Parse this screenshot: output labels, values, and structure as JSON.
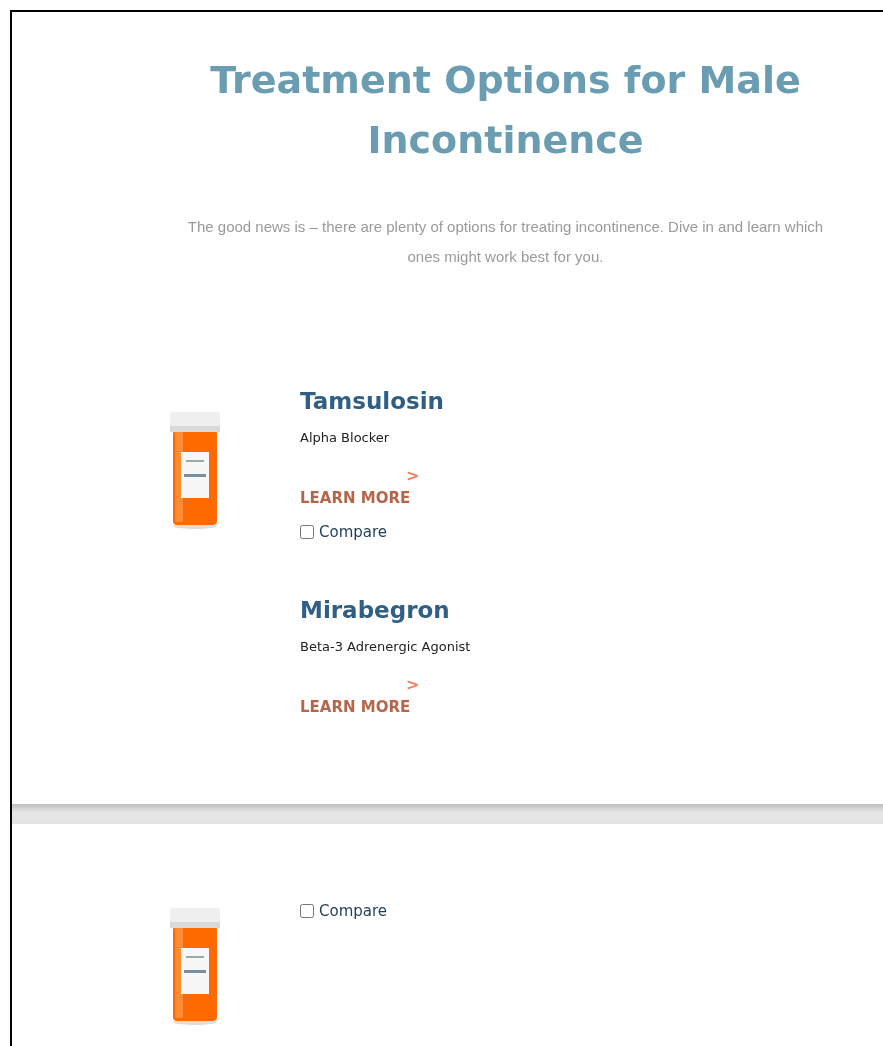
{
  "heading": "Treatment Options for Male Incontinence",
  "intro": "The good news is – there are plenty of options for treating incontinence. Dive in and learn which ones might work best for you.",
  "products": [
    {
      "name": "Tamsulosin",
      "category": "Alpha Blocker",
      "chevron": ">",
      "link": "LEARN MORE",
      "picture": true,
      "compare": {
        "label": "Compare",
        "checked": false
      }
    },
    {
      "name": "Mirabegron",
      "category": "Beta-3 Adrenergic Agonist",
      "chevron": ">",
      "link": "LEARN MORE",
      "picture": false
    }
  ],
  "next_section": {
    "picture": true,
    "compare": {
      "label": "Compare",
      "checked": false
    }
  }
}
